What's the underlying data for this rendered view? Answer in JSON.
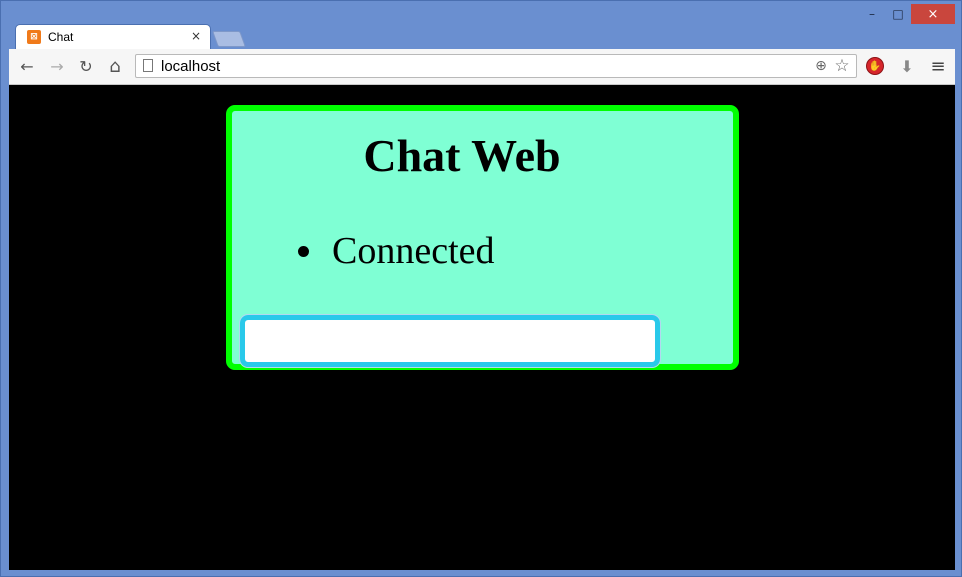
{
  "browser": {
    "tab": {
      "title": "Chat",
      "favicon": "xampp-icon",
      "close_glyph": "×"
    },
    "window_controls": {
      "minimize": "–",
      "maximize": "□",
      "close": "×"
    },
    "toolbar": {
      "back_glyph": "←",
      "forward_glyph": "→",
      "reload_glyph": "↻",
      "home_glyph": "⌂",
      "url": "localhost",
      "zoom_glyph": "⊕",
      "bookmark_glyph": "☆",
      "menu_glyph": "≡",
      "download_glyph": "⬇"
    },
    "colors": {
      "frame": "#6a8fd0",
      "close_button": "#c9463d",
      "extension_red": "#d6262b"
    }
  },
  "page": {
    "title": "Chat Web",
    "status_items": [
      "Connected"
    ],
    "message_input": {
      "value": "",
      "placeholder": ""
    },
    "colors": {
      "background": "#000000",
      "panel": "#7fffd4",
      "panel_border": "#00ff00",
      "input_border": "#29c9ea"
    }
  }
}
